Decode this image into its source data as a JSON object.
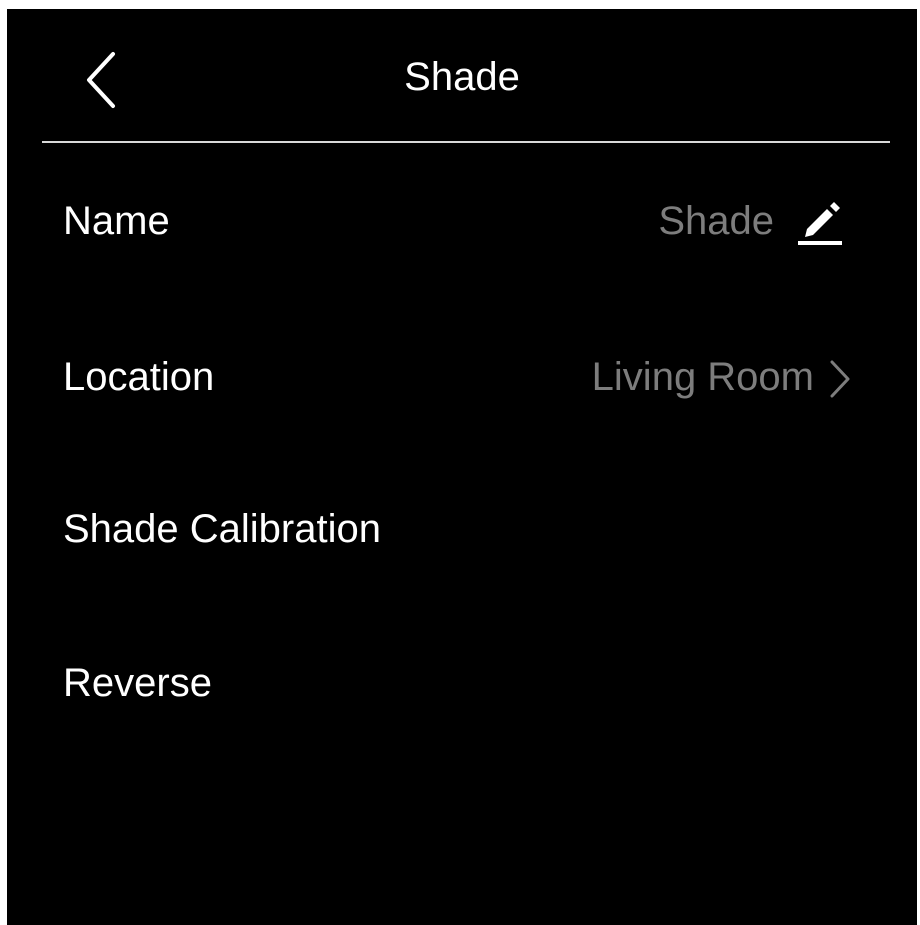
{
  "header": {
    "title": "Shade",
    "back_icon": "chevron-left-icon"
  },
  "settings": {
    "name": {
      "label": "Name",
      "value": "Shade",
      "icon": "edit-icon"
    },
    "location": {
      "label": "Location",
      "value": "Living Room",
      "icon": "chevron-right-icon"
    },
    "calibration": {
      "label": "Shade Calibration"
    },
    "reverse": {
      "label": "Reverse"
    }
  },
  "colors": {
    "background": "#000000",
    "primary_text": "#ffffff",
    "secondary_text": "#7d7d7d",
    "divider": "#d9d9d9"
  }
}
